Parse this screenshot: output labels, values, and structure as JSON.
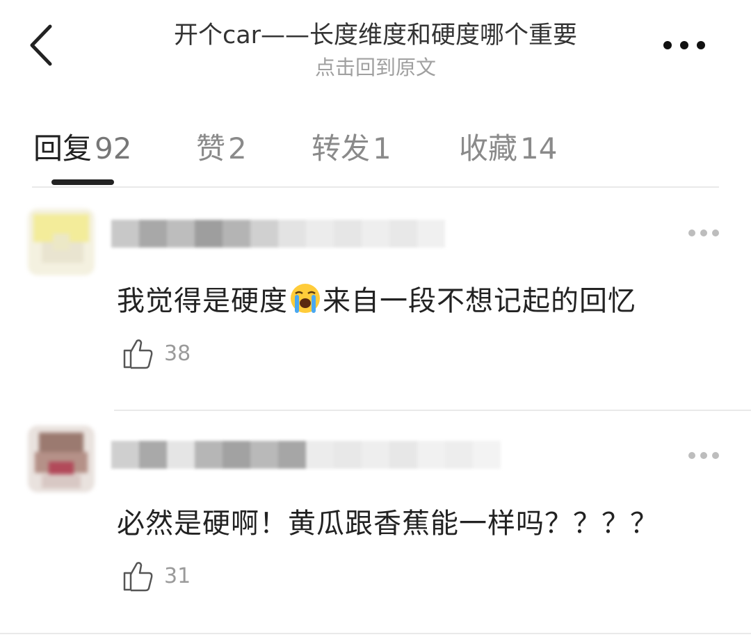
{
  "header": {
    "title": "开个car——长度维度和硬度哪个重要",
    "subtitle": "点击回到原文",
    "back_icon": "chevron-left-icon",
    "more_icon": "more-horizontal-icon"
  },
  "tabs": [
    {
      "label": "回复",
      "count": "92",
      "active": true
    },
    {
      "label": "赞",
      "count": "2",
      "active": false
    },
    {
      "label": "转发",
      "count": "1",
      "active": false
    },
    {
      "label": "收藏",
      "count": "14",
      "active": false
    }
  ],
  "comments": [
    {
      "text_before_emoji": "我觉得是硬度",
      "emoji": "loudly-crying-face-emoji",
      "text_after_emoji": "来自一段不想记起的回忆",
      "likes": "38"
    },
    {
      "text": "必然是硬啊！黄瓜跟香蕉能一样吗？？？？",
      "likes": "31"
    }
  ],
  "colors": {
    "text": "#222222",
    "muted": "#8a8a8a",
    "subtitle": "#a0a0a0",
    "divider": "#e9e9e9"
  }
}
